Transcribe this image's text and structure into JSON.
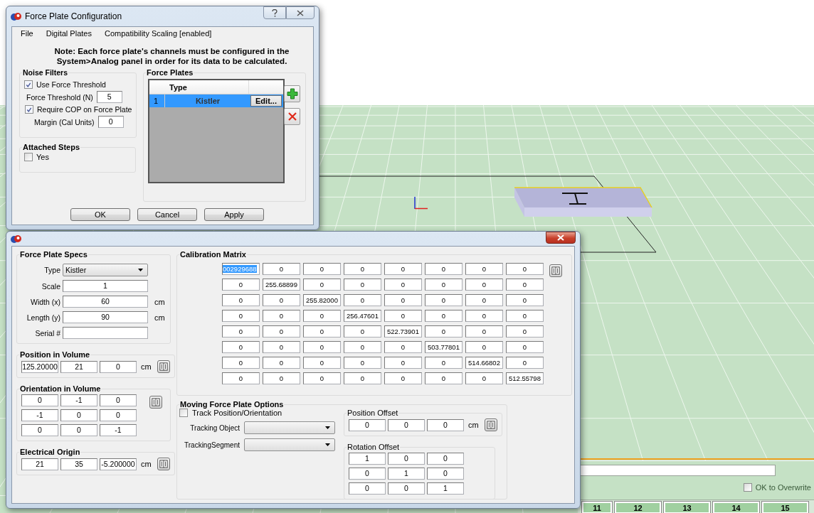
{
  "config_dialog": {
    "title": "Force Plate Configuration",
    "menu": [
      {
        "label": "File"
      },
      {
        "label": "Digital Plates"
      },
      {
        "label": "Compatibility Scaling [enabled]"
      }
    ],
    "note": "Note: Each force plate's channels must be configured in the System>Analog panel in order for its data to be calculated.",
    "noise_filters": {
      "title": "Noise Filters",
      "use_force_threshold": {
        "label": "Use Force Threshold",
        "checked": true
      },
      "force_threshold": {
        "label": "Force Threshold (N)",
        "value": "5"
      },
      "require_cop": {
        "label": "Require COP on Force Plate",
        "checked": true
      },
      "margin": {
        "label": "Margin (Cal Units)",
        "value": "0"
      }
    },
    "attached_steps": {
      "title": "Attached Steps",
      "yes": {
        "label": "Yes",
        "checked": false
      }
    },
    "force_plates": {
      "title": "Force Plates",
      "columns": [
        "Type"
      ],
      "rows": [
        {
          "index": "1",
          "type": "Kistler",
          "action": "Edit...",
          "selected": true
        }
      ]
    },
    "buttons": [
      "OK",
      "Cancel",
      "Apply"
    ]
  },
  "specs_dialog": {
    "force_plate_specs": {
      "title": "Force Plate Specs",
      "fields": [
        {
          "label": "Type",
          "kind": "dropdown",
          "value": "Kistler"
        },
        {
          "label": "Scale",
          "kind": "text",
          "value": "1"
        },
        {
          "label": "Width (x)",
          "kind": "text",
          "value": "60",
          "unit": "cm"
        },
        {
          "label": "Length (y)",
          "kind": "text",
          "value": "90",
          "unit": "cm"
        },
        {
          "label": "Serial #",
          "kind": "text"
        }
      ]
    },
    "position": {
      "title": "Position in Volume",
      "values": [
        "125.20000",
        "21",
        "0"
      ],
      "unit": "cm"
    },
    "orientation": {
      "title": "Orientation in Volume",
      "rows": [
        [
          "0",
          "-1",
          "0"
        ],
        [
          "-1",
          "0",
          "0"
        ],
        [
          "0",
          "0",
          "-1"
        ]
      ]
    },
    "electrical_origin": {
      "title": "Electrical Origin",
      "values": [
        "21",
        "35",
        "-5.200000"
      ],
      "unit": "cm"
    },
    "calibration": {
      "title": "Calibration Matrix",
      "rows": [
        [
          {
            "value": "002929688",
            "selected": true
          },
          {
            "value": "0",
            "selected": false
          },
          {
            "value": "0",
            "selected": false
          },
          {
            "value": "0",
            "selected": false
          },
          {
            "value": "0",
            "selected": false
          },
          {
            "value": "0",
            "selected": false
          },
          {
            "value": "0",
            "selected": false
          },
          {
            "value": "0",
            "selected": false
          }
        ],
        [
          {
            "value": "0",
            "selected": false
          },
          {
            "value": "255.68899",
            "selected": false
          },
          {
            "value": "0",
            "selected": false
          },
          {
            "value": "0",
            "selected": false
          },
          {
            "value": "0",
            "selected": false
          },
          {
            "value": "0",
            "selected": false
          },
          {
            "value": "0",
            "selected": false
          },
          {
            "value": "0",
            "selected": false
          }
        ],
        [
          {
            "value": "0",
            "selected": false
          },
          {
            "value": "0",
            "selected": false
          },
          {
            "value": "255.82000",
            "selected": false
          },
          {
            "value": "0",
            "selected": false
          },
          {
            "value": "0",
            "selected": false
          },
          {
            "value": "0",
            "selected": false
          },
          {
            "value": "0",
            "selected": false
          },
          {
            "value": "0",
            "selected": false
          }
        ],
        [
          {
            "value": "0",
            "selected": false
          },
          {
            "value": "0",
            "selected": false
          },
          {
            "value": "0",
            "selected": false
          },
          {
            "value": "256.47601",
            "selected": false
          },
          {
            "value": "0",
            "selected": false
          },
          {
            "value": "0",
            "selected": false
          },
          {
            "value": "0",
            "selected": false
          },
          {
            "value": "0",
            "selected": false
          }
        ],
        [
          {
            "value": "0",
            "selected": false
          },
          {
            "value": "0",
            "selected": false
          },
          {
            "value": "0",
            "selected": false
          },
          {
            "value": "0",
            "selected": false
          },
          {
            "value": "522.73901",
            "selected": false
          },
          {
            "value": "0",
            "selected": false
          },
          {
            "value": "0",
            "selected": false
          },
          {
            "value": "0",
            "selected": false
          }
        ],
        [
          {
            "value": "0",
            "selected": false
          },
          {
            "value": "0",
            "selected": false
          },
          {
            "value": "0",
            "selected": false
          },
          {
            "value": "0",
            "selected": false
          },
          {
            "value": "0",
            "selected": false
          },
          {
            "value": "503.77801",
            "selected": false
          },
          {
            "value": "0",
            "selected": false
          },
          {
            "value": "0",
            "selected": false
          }
        ],
        [
          {
            "value": "0",
            "selected": false
          },
          {
            "value": "0",
            "selected": false
          },
          {
            "value": "0",
            "selected": false
          },
          {
            "value": "0",
            "selected": false
          },
          {
            "value": "0",
            "selected": false
          },
          {
            "value": "0",
            "selected": false
          },
          {
            "value": "514.66802",
            "selected": false
          },
          {
            "value": "0",
            "selected": false
          }
        ],
        [
          {
            "value": "0",
            "selected": false
          },
          {
            "value": "0",
            "selected": false
          },
          {
            "value": "0",
            "selected": false
          },
          {
            "value": "0",
            "selected": false
          },
          {
            "value": "0",
            "selected": false
          },
          {
            "value": "0",
            "selected": false
          },
          {
            "value": "0",
            "selected": false
          },
          {
            "value": "512.55798",
            "selected": false
          }
        ]
      ]
    },
    "moving": {
      "title": "Moving Force Plate Options",
      "track": {
        "label": "Track Position/Orientation",
        "checked": false
      },
      "tracking_object": {
        "label": "Tracking Object"
      },
      "tracking_segment": {
        "label": "TrackingSegment"
      },
      "position_offset": {
        "title": "Position Offset",
        "values": [
          "0",
          "0",
          "0"
        ],
        "unit": "cm"
      },
      "rotation_offset": {
        "title": "Rotation Offset",
        "rows": [
          [
            "1",
            "0",
            "0"
          ],
          [
            "0",
            "1",
            "0"
          ],
          [
            "0",
            "0",
            "1"
          ]
        ]
      }
    }
  },
  "background": {
    "overwrite": {
      "label": "OK to Overwrite",
      "checked": false
    },
    "frame_buttons": [
      "11",
      "12",
      "13",
      "14",
      "15"
    ]
  }
}
